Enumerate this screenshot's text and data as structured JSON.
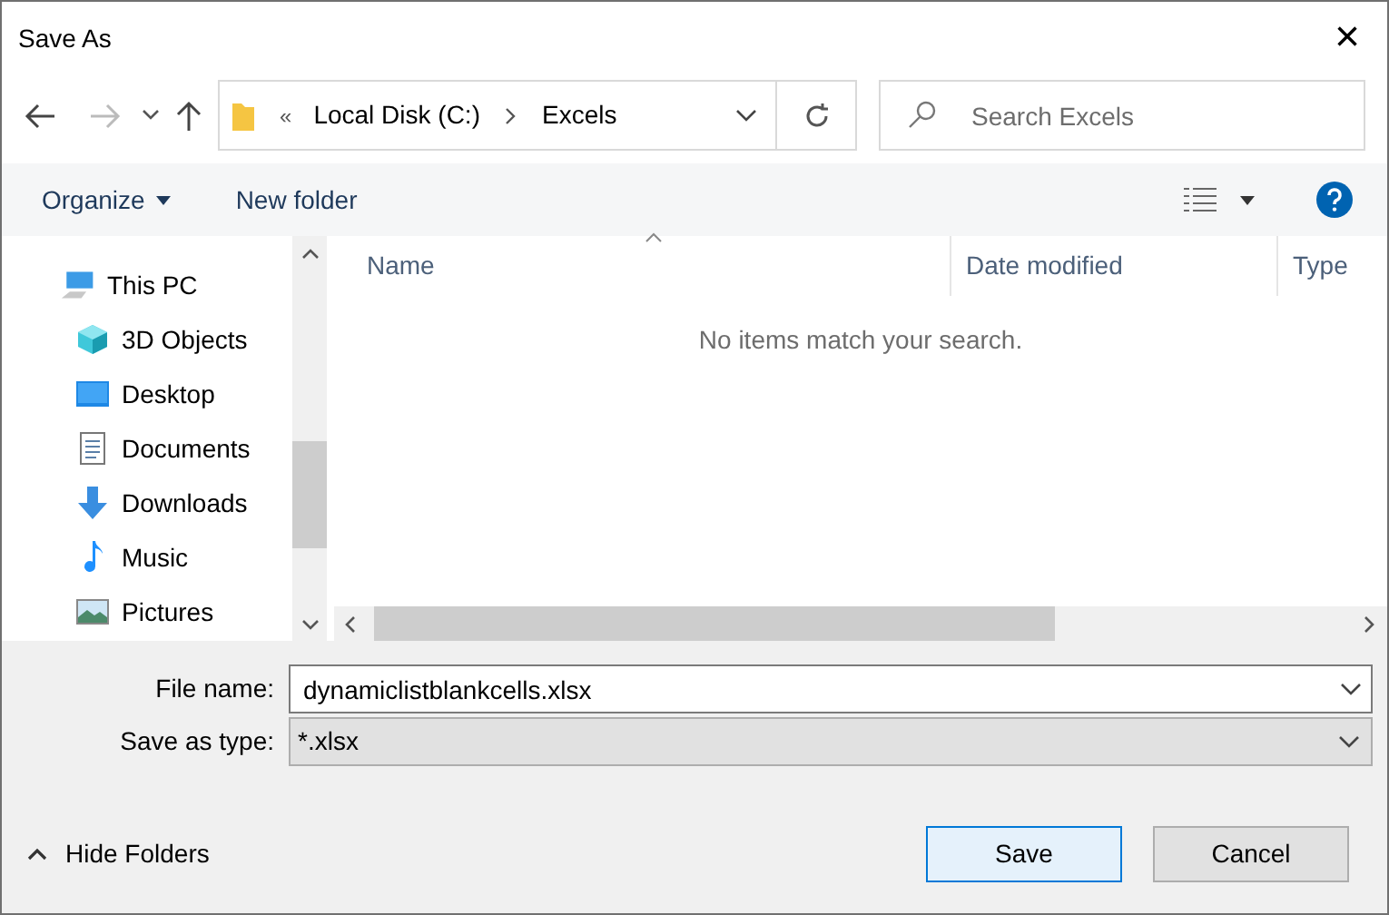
{
  "window": {
    "title": "Save As",
    "close": "×"
  },
  "address": {
    "overflow": "«",
    "segments": [
      "Local Disk (C:)",
      "Excels"
    ]
  },
  "search": {
    "placeholder": "Search Excels"
  },
  "toolbar": {
    "organize": "Organize",
    "new_folder": "New folder"
  },
  "sidebar": {
    "items": [
      {
        "label": "This PC",
        "children": [
          {
            "label": "3D Objects"
          },
          {
            "label": "Desktop"
          },
          {
            "label": "Documents"
          },
          {
            "label": "Downloads"
          },
          {
            "label": "Music"
          },
          {
            "label": "Pictures"
          }
        ]
      }
    ]
  },
  "table": {
    "columns": [
      "Name",
      "Date modified",
      "Type"
    ],
    "empty_message": "No items match your search."
  },
  "form": {
    "file_name_label": "File name:",
    "file_name": "dynamiclistblankcells.xlsx",
    "type_label": "Save as type:",
    "type": "*.xlsx"
  },
  "hide_folders": "Hide Folders",
  "buttons": [
    {
      "label": "Save",
      "default": true
    },
    {
      "label": "Cancel",
      "default": false
    }
  ]
}
